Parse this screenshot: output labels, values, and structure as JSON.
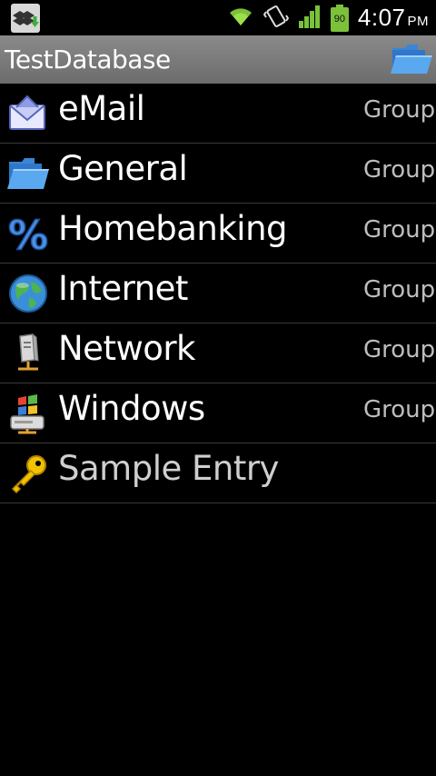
{
  "statusbar": {
    "time": "4:07",
    "ampm": "PM",
    "battery_level": "90",
    "icons": [
      "dropbox-icon",
      "wifi-icon",
      "vibrate-icon",
      "signal-icon",
      "battery-icon"
    ]
  },
  "header": {
    "title": "TestDatabase",
    "action_icon": "folder-open-icon"
  },
  "list": {
    "items": [
      {
        "label": "eMail",
        "type": "Group",
        "icon": "email-envelope-icon"
      },
      {
        "label": "General",
        "type": "Group",
        "icon": "folder-open-icon"
      },
      {
        "label": "Homebanking",
        "type": "Group",
        "icon": "percent-icon"
      },
      {
        "label": "Internet",
        "type": "Group",
        "icon": "globe-icon"
      },
      {
        "label": "Network",
        "type": "Group",
        "icon": "server-network-icon"
      },
      {
        "label": "Windows",
        "type": "Group",
        "icon": "windows-drive-icon"
      },
      {
        "label": "Sample Entry",
        "type": "",
        "icon": "key-icon"
      }
    ]
  },
  "colors": {
    "background": "#000000",
    "header_bg": "#7a7a7a",
    "divider": "#3a3a3a",
    "secondary_text": "#bdbdbd",
    "signal_green": "#7bc13a"
  }
}
